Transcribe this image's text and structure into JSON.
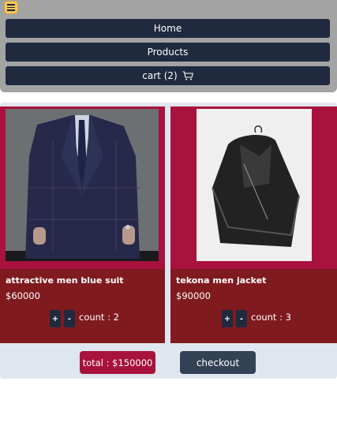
{
  "nav": {
    "home_label": "Home",
    "products_label": "Products",
    "cart_label": "cart (2)"
  },
  "products": [
    {
      "name": "attractive men blue suit",
      "price": "$60000",
      "count_label": "count : 2",
      "plus": "+",
      "minus": "-"
    },
    {
      "name": "tekona men jacket",
      "price": "$90000",
      "count_label": "count : 3",
      "plus": "+",
      "minus": "-"
    }
  ],
  "summary": {
    "total_label": "total : $150000",
    "checkout_label": "checkout"
  },
  "colors": {
    "nav_bg": "#1f2a3f",
    "card_bg": "#a8123c",
    "info_bg": "#7f1a1f",
    "checkout_bg": "#334155",
    "menu_button": "#f4c65a"
  },
  "icons": [
    "hamburger-menu-icon",
    "cart-icon"
  ]
}
